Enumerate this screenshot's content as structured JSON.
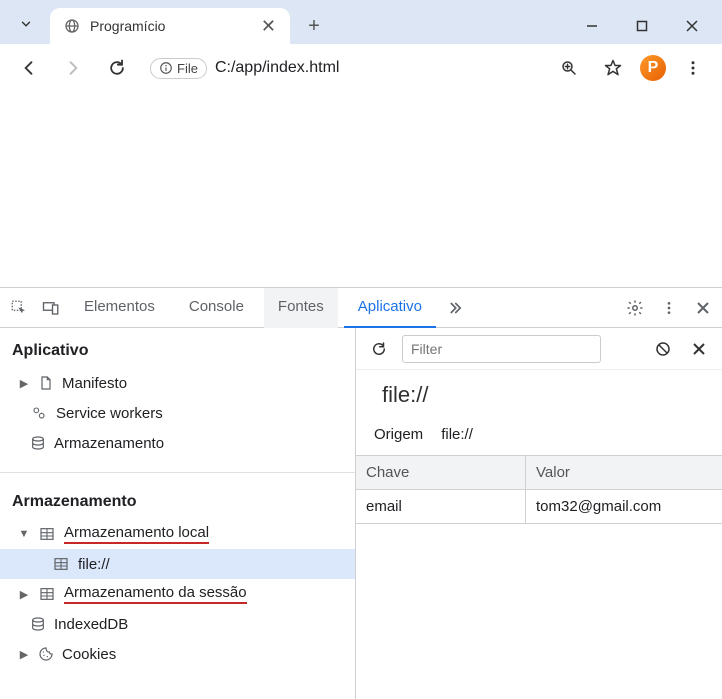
{
  "browser": {
    "tab_title": "Programício",
    "url": "C:/app/index.html",
    "file_pill": "File"
  },
  "devtools": {
    "tabs": {
      "elements": "Elementos",
      "console": "Console",
      "sources": "Fontes",
      "application": "Aplicativo"
    },
    "sidebar": {
      "app_section": "Aplicativo",
      "manifest": "Manifesto",
      "service_workers": "Service workers",
      "storage": "Armazenamento",
      "storage_section": "Armazenamento",
      "local_storage": "Armazenamento local",
      "local_storage_item": "file://",
      "session_storage": "Armazenamento da sessão",
      "indexeddb": "IndexedDB",
      "cookies": "Cookies"
    },
    "main": {
      "filter_placeholder": "Filter",
      "origin_big": "file://",
      "origin_label": "Origem",
      "origin_value": "file://",
      "table": {
        "key_header": "Chave",
        "value_header": "Valor",
        "rows": [
          {
            "key": "email",
            "value": "tom32@gmail.com"
          }
        ]
      }
    }
  },
  "ext_badge": "P"
}
